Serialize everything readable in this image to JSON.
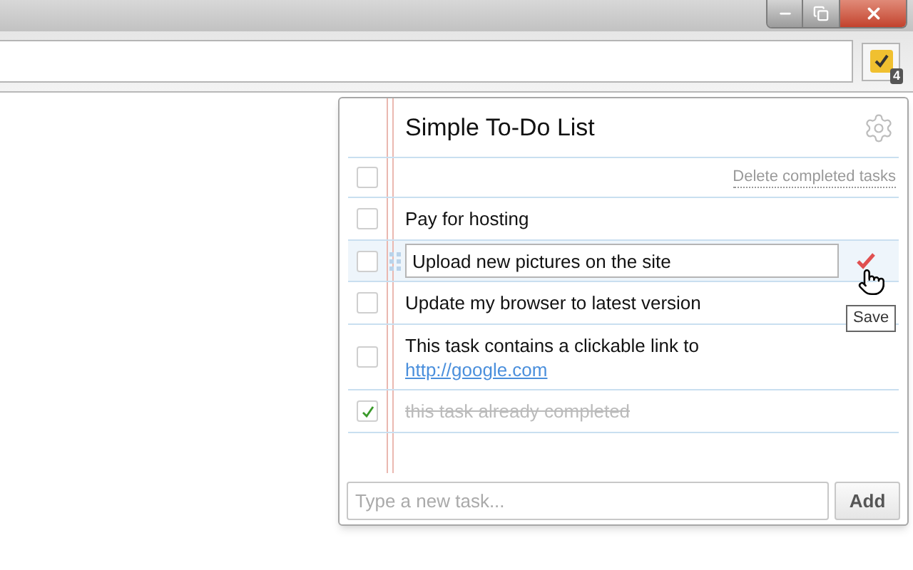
{
  "extension": {
    "badge": "4"
  },
  "popup": {
    "title": "Simple To-Do List",
    "select_all": {
      "checked": false
    },
    "delete_link": "Delete completed tasks",
    "tasks": [
      {
        "text": "Pay for hosting",
        "checked": false,
        "editing": false
      },
      {
        "text": "Upload new pictures on the site",
        "checked": false,
        "editing": true
      },
      {
        "text": "Update my browser to latest version",
        "checked": false,
        "editing": false
      },
      {
        "text": "This task contains a clickable link to",
        "link": "http://google.com",
        "checked": false,
        "editing": false
      },
      {
        "text": "this task already completed",
        "checked": true,
        "editing": false
      }
    ],
    "tooltip": "Save",
    "new_task": {
      "placeholder": "Type a new task..."
    },
    "add_button": "Add"
  }
}
